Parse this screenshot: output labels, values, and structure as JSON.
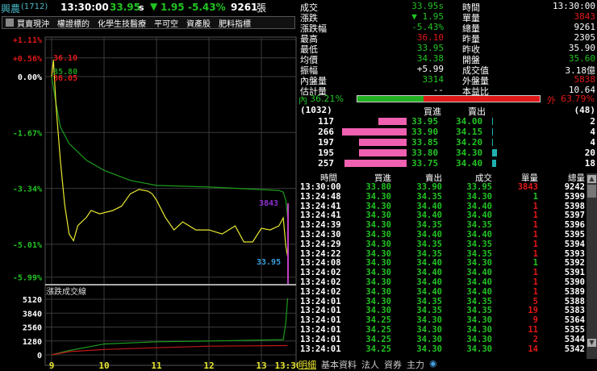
{
  "header": {
    "name": "興農",
    "code": "(1712)",
    "time": "13:30:00",
    "price": "33.95",
    "flag": "s",
    "arrow": "▼",
    "change": "1.95",
    "pct": "-5.43%",
    "volume": "9261",
    "unit": "張"
  },
  "tags": [
    "買賣現沖",
    "權證標的",
    "化學生技醫療",
    "平可空",
    "資產股",
    "肥料指標"
  ],
  "chart": {
    "y_labels": [
      "+1.11%",
      "+0.56%",
      "0.00%",
      "-1.67%",
      "-3.34%",
      "-5.01%",
      "-5.99%"
    ],
    "marks": {
      "high": "36.10",
      "avg_open": "35.80",
      "open": "36.05",
      "last_vol": "3843",
      "last": "33.95"
    },
    "vol_title": "漲跌成交線",
    "vol_labels": [
      "5120",
      "3840",
      "2560",
      "1280",
      "0"
    ],
    "x_labels": [
      "9",
      "10",
      "11",
      "12",
      "13",
      "13:30"
    ]
  },
  "chart_data": {
    "type": "line",
    "x_unit": "minutes after 9:00",
    "price_pct": [
      [
        0,
        0
      ],
      [
        2,
        0.5
      ],
      [
        5,
        -0.85
      ],
      [
        10,
        -2.5
      ],
      [
        15,
        -3.85
      ],
      [
        20,
        -4.7
      ],
      [
        25,
        -4.9
      ],
      [
        30,
        -4.45
      ],
      [
        40,
        -4.2
      ],
      [
        45,
        -4.0
      ],
      [
        55,
        -4.1
      ],
      [
        70,
        -4.0
      ],
      [
        80,
        -3.87
      ],
      [
        90,
        -3.5
      ],
      [
        100,
        -3.37
      ],
      [
        110,
        -3.42
      ],
      [
        115,
        -3.5
      ],
      [
        120,
        -3.69
      ],
      [
        130,
        -4.2
      ],
      [
        140,
        -4.58
      ],
      [
        150,
        -4.34
      ],
      [
        165,
        -4.58
      ],
      [
        180,
        -4.58
      ],
      [
        195,
        -4.7
      ],
      [
        210,
        -4.46
      ],
      [
        220,
        -4.94
      ],
      [
        230,
        -4.94
      ],
      [
        240,
        -4.53
      ],
      [
        250,
        -4.58
      ],
      [
        260,
        -4.46
      ],
      [
        265,
        -4.22
      ],
      [
        268,
        -5.06
      ],
      [
        270,
        -5.37
      ]
    ],
    "avg_pct": [
      [
        0,
        0
      ],
      [
        5,
        -0.8
      ],
      [
        10,
        -1.5
      ],
      [
        20,
        -2.0
      ],
      [
        40,
        -2.5
      ],
      [
        60,
        -2.8
      ],
      [
        90,
        -3.1
      ],
      [
        120,
        -3.25
      ],
      [
        180,
        -3.3
      ],
      [
        260,
        -3.4
      ],
      [
        265,
        -3.45
      ],
      [
        268,
        -3.7
      ],
      [
        270,
        -4.2
      ]
    ],
    "cum_up": [
      [
        0,
        0
      ],
      [
        20,
        400
      ],
      [
        60,
        1000
      ],
      [
        120,
        1200
      ],
      [
        180,
        1280
      ],
      [
        265,
        1400
      ],
      [
        268,
        3000
      ],
      [
        270,
        5200
      ]
    ],
    "cum_down": [
      [
        0,
        0
      ],
      [
        20,
        300
      ],
      [
        60,
        500
      ],
      [
        120,
        650
      ],
      [
        180,
        800
      ],
      [
        265,
        850
      ],
      [
        270,
        850
      ]
    ]
  },
  "quote": {
    "left": [
      [
        "成交",
        "33.95s",
        "g"
      ],
      [
        "漲跌",
        "▼ 1.95",
        "g"
      ],
      [
        "漲跌幅",
        "-5.43%",
        "g"
      ],
      [
        "最高",
        "36.10",
        "r"
      ],
      [
        "最低",
        "33.95",
        "g"
      ],
      [
        "均價",
        "34.38",
        "g"
      ],
      [
        "振幅",
        "+5.99",
        "w"
      ],
      [
        "內盤量",
        "3314",
        "g"
      ],
      [
        "估計量",
        "--",
        "w"
      ]
    ],
    "right": [
      [
        "時間",
        "13:30:00",
        "w"
      ],
      [
        "單量",
        "3843",
        "r"
      ],
      [
        "總量",
        "9261",
        "w"
      ],
      [
        "昨量",
        "2305",
        "w"
      ],
      [
        "昨收",
        "35.90",
        "w"
      ],
      [
        "開盤",
        "35.60",
        "g"
      ],
      [
        "成交值",
        "3.18億",
        "w"
      ],
      [
        "外盤量",
        "5838",
        "r"
      ],
      [
        "本益比",
        "10.64",
        "w"
      ]
    ]
  },
  "ratio": {
    "in_label": "內",
    "in_pct": "36.21%",
    "out_label": "外",
    "out_pct": "63.79%",
    "in_fraction": 0.3621
  },
  "book": {
    "bid_total": "(1032)",
    "ask_total": "(48)",
    "bid_header": "買進",
    "ask_header": "賣出",
    "rows": [
      [
        "117",
        "33.95",
        "34.00",
        "2"
      ],
      [
        "266",
        "33.90",
        "34.15",
        "4"
      ],
      [
        "197",
        "33.85",
        "34.20",
        "4"
      ],
      [
        "195",
        "33.80",
        "34.30",
        "20"
      ],
      [
        "257",
        "33.75",
        "34.40",
        "18"
      ]
    ]
  },
  "ticks": {
    "headers": [
      "時間",
      "買進",
      "賣出",
      "成交",
      "單量",
      "總量"
    ],
    "rows": [
      [
        "13:30:00",
        "33.80",
        "33.90",
        "33.95",
        "3843",
        "9242",
        "r"
      ],
      [
        "13:24:48",
        "34.30",
        "34.35",
        "34.30",
        "1",
        "5399",
        "g"
      ],
      [
        "13:24:41",
        "34.30",
        "34.40",
        "34.40",
        "1",
        "5398",
        "r"
      ],
      [
        "13:24:41",
        "34.30",
        "34.40",
        "34.40",
        "1",
        "5397",
        "r"
      ],
      [
        "13:24:39",
        "34.30",
        "34.35",
        "34.35",
        "1",
        "5396",
        "r"
      ],
      [
        "13:24:30",
        "34.30",
        "34.40",
        "34.40",
        "1",
        "5395",
        "r"
      ],
      [
        "13:24:29",
        "34.30",
        "34.35",
        "34.35",
        "1",
        "5394",
        "r"
      ],
      [
        "13:24:22",
        "34.30",
        "34.35",
        "34.35",
        "1",
        "5393",
        "r"
      ],
      [
        "13:24:08",
        "34.30",
        "34.40",
        "34.30",
        "1",
        "5392",
        "g"
      ],
      [
        "13:24:02",
        "34.30",
        "34.40",
        "34.40",
        "1",
        "5391",
        "r"
      ],
      [
        "13:24:02",
        "34.30",
        "34.40",
        "34.40",
        "1",
        "5390",
        "r"
      ],
      [
        "13:24:02",
        "34.30",
        "34.40",
        "34.40",
        "1",
        "5389",
        "r"
      ],
      [
        "13:24:01",
        "34.30",
        "34.35",
        "34.35",
        "5",
        "5388",
        "r"
      ],
      [
        "13:24:01",
        "34.30",
        "34.35",
        "34.35",
        "19",
        "5383",
        "r"
      ],
      [
        "13:24:01",
        "34.25",
        "34.30",
        "34.30",
        "9",
        "5364",
        "r"
      ],
      [
        "13:24:01",
        "34.25",
        "34.30",
        "34.30",
        "11",
        "5355",
        "r"
      ],
      [
        "13:24:01",
        "34.25",
        "34.30",
        "34.30",
        "2",
        "5344",
        "r"
      ],
      [
        "13:24:01",
        "34.25",
        "34.30",
        "34.30",
        "14",
        "5342",
        "r"
      ]
    ]
  },
  "tabs": [
    "明細",
    "基本資料",
    "法人",
    "資券",
    "主力"
  ]
}
